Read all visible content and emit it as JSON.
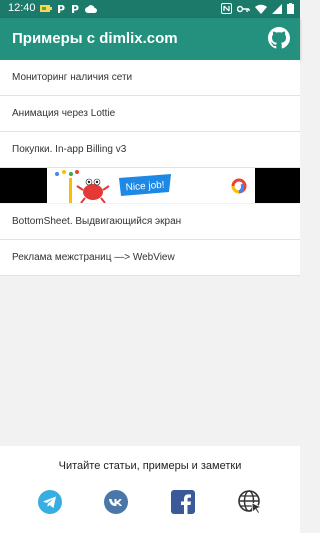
{
  "status_bar": {
    "time": "12:40",
    "left_icons": [
      "battery-saver-icon",
      "p-icon",
      "p-icon",
      "cloud-icon"
    ],
    "right_icons": [
      "nfc-icon",
      "key-icon",
      "wifi-icon",
      "signal-icon",
      "battery-icon"
    ]
  },
  "app_bar": {
    "title": "Примеры с dimlix.com",
    "action_icon": "github-icon"
  },
  "menu": {
    "items": [
      {
        "label": "Мониторинг наличия сети"
      },
      {
        "label": "Анимация через Lottie"
      },
      {
        "label": "Покупки. In-app Billing v3"
      }
    ]
  },
  "banner": {
    "text": "Nice job!",
    "colors": {
      "bg": "#000000",
      "accent": "#1e88e5"
    }
  },
  "menu2": {
    "items": [
      {
        "label": "BottomSheet. Выдвигающийся экран"
      },
      {
        "label": "Реклама межстраниц —> WebView"
      }
    ]
  },
  "footer": {
    "text": "Читайте статьи, примеры и заметки",
    "social": [
      "telegram-icon",
      "vk-icon",
      "facebook-icon",
      "web-icon"
    ]
  },
  "colors": {
    "status_bar": "#1c7a6b",
    "app_bar": "#23917e",
    "telegram": "#37aee2",
    "vk": "#4a76a8",
    "facebook": "#3b5998"
  }
}
